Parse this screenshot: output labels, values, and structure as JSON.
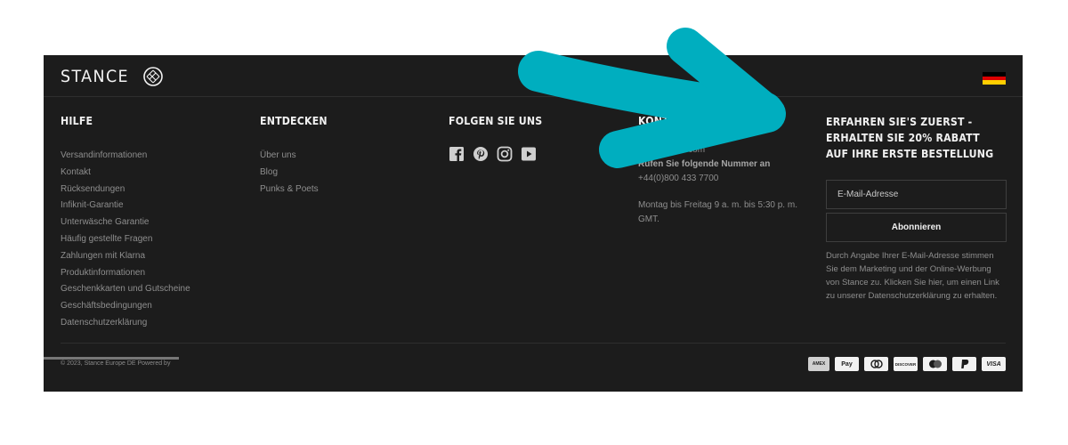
{
  "brand": {
    "logo_text": "STANCE"
  },
  "columns": {
    "help": {
      "title": "HILFE",
      "links": [
        "Versandinformationen",
        "Kontakt",
        "Rücksendungen",
        "Infiknit-Garantie",
        "Unterwäsche Garantie",
        "Häufig gestellte Fragen",
        "Zahlungen mit Klarna",
        "Produktinformationen",
        "Geschenkkarten und Gutscheine",
        "Geschäftsbedingungen",
        "Datenschutzerklärung"
      ]
    },
    "discover": {
      "title": "ENTDECKEN",
      "links": [
        "Über uns",
        "Blog",
        "Punks & Poets"
      ]
    },
    "follow": {
      "title": "FOLGEN SIE UNS",
      "icons": [
        "facebook-icon",
        "pinterest-icon",
        "instagram-icon",
        "youtube-icon"
      ]
    },
    "contact": {
      "title": "KONTAKT",
      "email": "…stance.eu.com",
      "call_label": "Rufen Sie folgende Nummer an",
      "phone": "+44(0)800 433 7700",
      "hours": "Montag bis Freitag 9 a. m. bis 5:30 p. m. GMT."
    }
  },
  "newsletter": {
    "title": "ERFAHREN SIE'S ZUERST - ERHALTEN SIE 20% RABATT AUF IHRE ERSTE BESTELLUNG",
    "email_placeholder": "E-Mail-Adresse",
    "subscribe_label": "Abonnieren",
    "disclaimer": "Durch Angabe Ihrer E-Mail-Adresse stimmen Sie dem Marketing und der Online-Werbung von Stance zu. Klicken Sie hier, um einen Link zu unserer Datenschutzerklärung zu erhalten."
  },
  "bottom": {
    "copyright": "© 2023, Stance Europe DE Powered by",
    "payments": [
      "AMEX",
      "Pay",
      "Diners",
      "DISCOVER",
      "Mastercard",
      "PayPal",
      "VISA"
    ]
  },
  "colors": {
    "background": "#1c1c1c",
    "annotation_arrow": "#00aebf",
    "flag": [
      "#000000",
      "#dd0000",
      "#ffce00"
    ]
  }
}
